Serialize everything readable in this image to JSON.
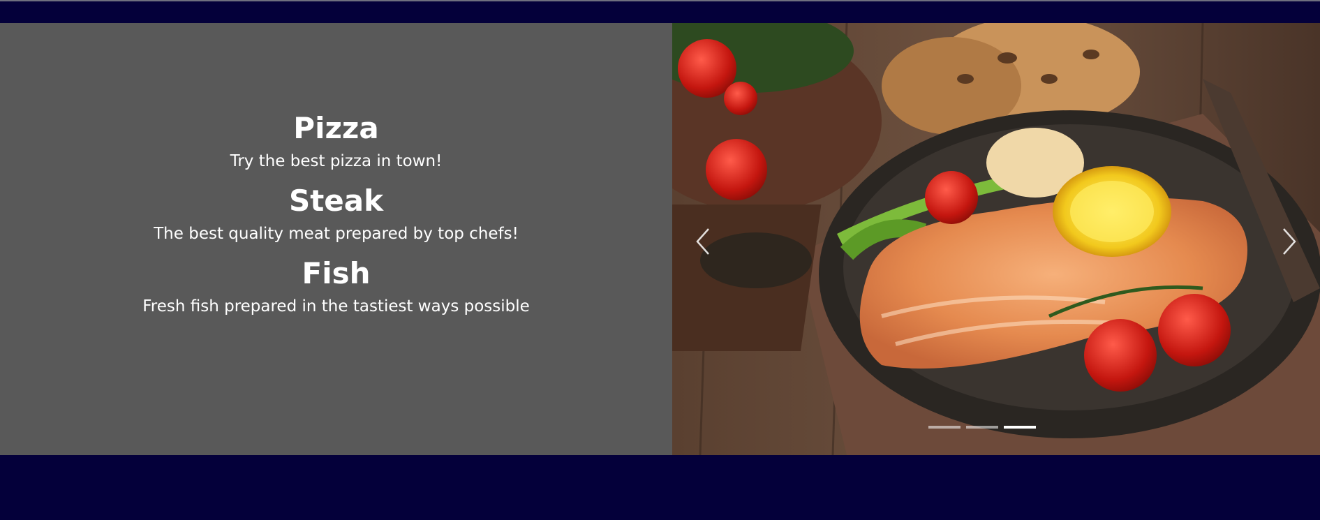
{
  "menu": {
    "items": [
      {
        "title": "Pizza",
        "description": "Try the best pizza in town!"
      },
      {
        "title": "Steak",
        "description": "The best quality meat prepared by top chefs!"
      },
      {
        "title": "Fish",
        "description": "Fresh fish prepared in the tastiest ways possible"
      }
    ]
  },
  "carousel": {
    "slide_count": 3,
    "active_slide": 3,
    "icons": {
      "prev": "chevron-left-icon",
      "next": "chevron-right-icon"
    }
  },
  "colors": {
    "header": "#04003a",
    "panel": "#595959",
    "text": "#ffffff"
  }
}
